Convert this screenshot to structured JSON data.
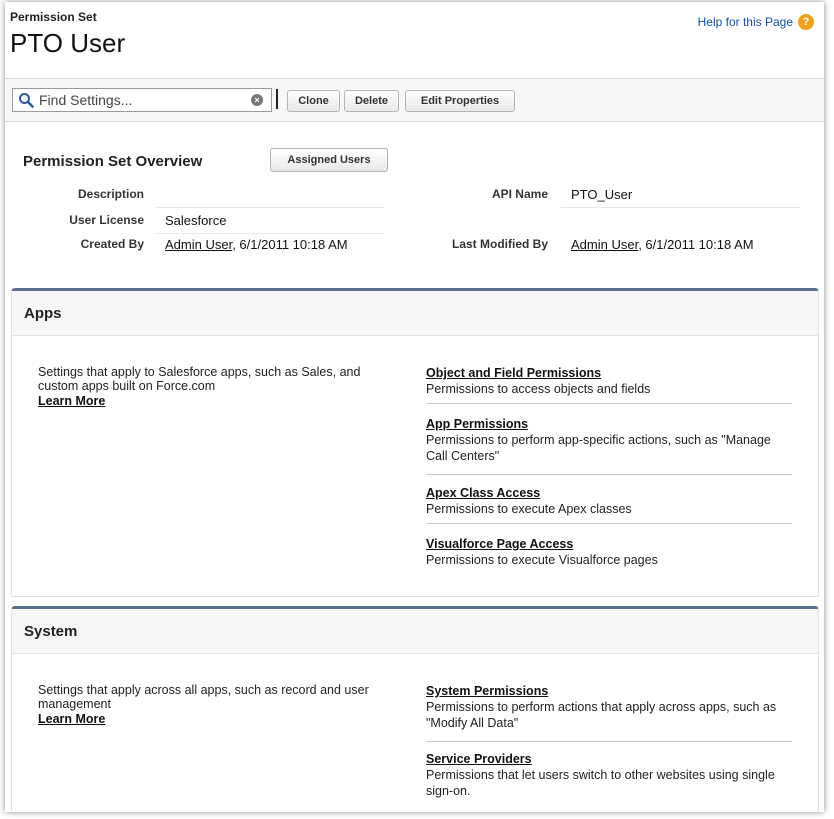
{
  "header": {
    "kicker": "Permission Set",
    "title": "PTO User",
    "help": "Help for this Page",
    "help_icon": "help-icon"
  },
  "toolbar": {
    "search_placeholder": "Find Settings...",
    "clone": "Clone",
    "delete": "Delete",
    "edit_properties": "Edit Properties"
  },
  "overview": {
    "title": "Permission Set Overview",
    "assigned_users": "Assigned Users",
    "description_label": "Description",
    "description_value": "",
    "api_name_label": "API Name",
    "api_name_value": "PTO_User",
    "user_license_label": "User License",
    "user_license_value": "Salesforce",
    "created_by_label": "Created By",
    "created_by_user": "Admin User",
    "created_by_date": ", 6/1/2011 10:18 AM",
    "last_modified_label": "Last Modified By",
    "last_modified_user": "Admin User",
    "last_modified_date": ", 6/1/2011 10:18 AM"
  },
  "apps": {
    "title": "Apps",
    "description": "Settings that apply to Salesforce apps, such as Sales, and custom apps built on Force.com",
    "learn_more": "Learn More",
    "items": [
      {
        "title": "Object and Field Permissions",
        "desc": "Permissions to access objects and fields"
      },
      {
        "title": "App Permissions",
        "desc": "Permissions to perform app-specific actions, such as \"Manage Call Centers\""
      },
      {
        "title": "Apex Class Access",
        "desc": "Permissions to execute Apex classes"
      },
      {
        "title": "Visualforce Page Access",
        "desc": "Permissions to execute Visualforce pages"
      }
    ]
  },
  "system": {
    "title": "System",
    "description": "Settings that apply across all apps, such as record and user management",
    "learn_more": "Learn More",
    "items": [
      {
        "title": "System Permissions",
        "desc": "Permissions to perform actions that apply across apps, such as \"Modify All Data\""
      },
      {
        "title": "Service Providers",
        "desc": "Permissions that let users switch to other websites using single sign-on."
      }
    ]
  },
  "colors": {
    "link": "#0f4fa8",
    "section_border": "#5a6f8f",
    "help_icon": "#f0a020"
  }
}
